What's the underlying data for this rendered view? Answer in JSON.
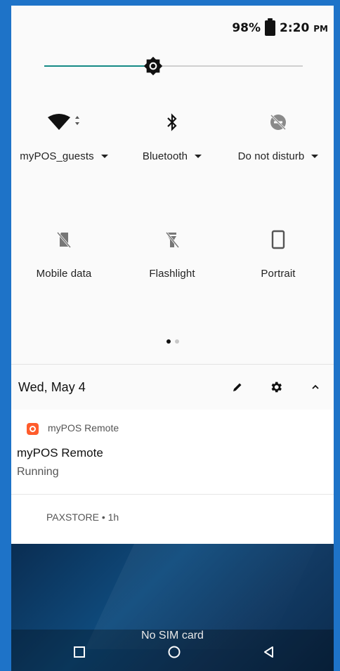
{
  "status": {
    "battery": "98%",
    "time": "2:20",
    "ampm": "PM"
  },
  "brightness": {
    "level_percent": 42
  },
  "tiles": {
    "wifi": {
      "label": "myPOS_guests",
      "icon": "wifi-icon"
    },
    "bluetooth": {
      "label": "Bluetooth",
      "icon": "bluetooth-icon"
    },
    "dnd": {
      "label": "Do not disturb",
      "icon": "do-not-disturb-icon"
    },
    "mobile_data": {
      "label": "Mobile data",
      "icon": "mobile-data-off-icon"
    },
    "flashlight": {
      "label": "Flashlight",
      "icon": "flashlight-off-icon"
    },
    "portrait": {
      "label": "Portrait",
      "icon": "portrait-icon"
    }
  },
  "pager": {
    "pages": 2,
    "active": 0
  },
  "date_row": {
    "date": "Wed, May 4"
  },
  "notifications": [
    {
      "app": "myPOS Remote",
      "title": "myPOS Remote",
      "text": "Running"
    },
    {
      "app": "PAXSTORE • 1h"
    }
  ],
  "lockscreen": {
    "carrier": "No SIM card"
  },
  "colors": {
    "accent": "#158a86",
    "frame": "#1e73c8",
    "app_icon": "#ff5c2c"
  }
}
